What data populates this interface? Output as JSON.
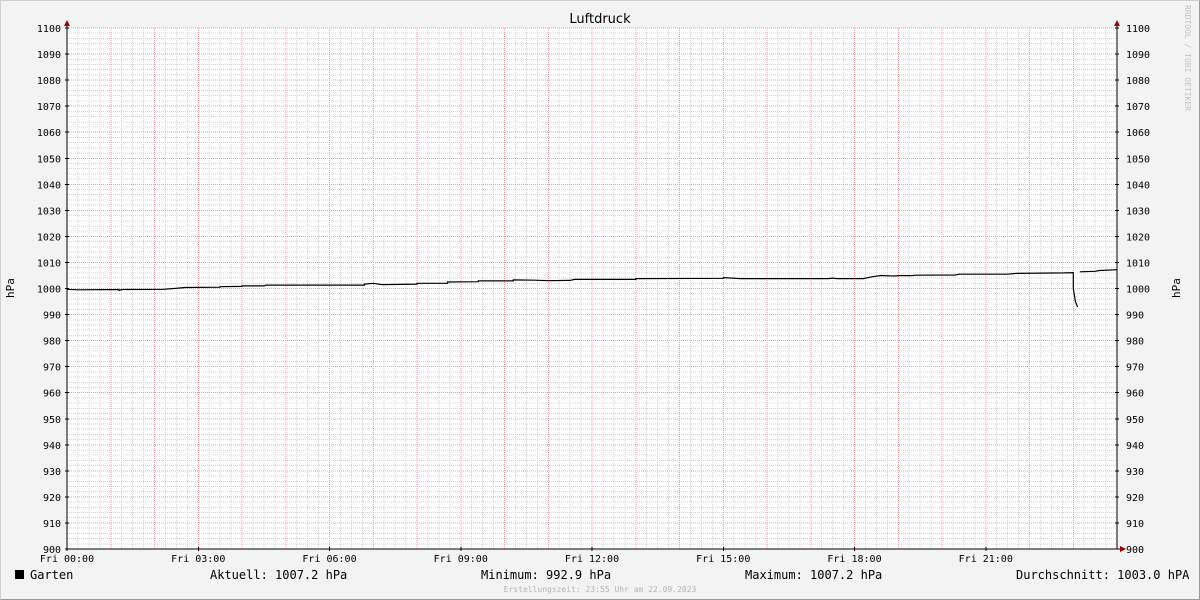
{
  "chart_data": {
    "type": "line",
    "title": "Luftdruck",
    "ylabel_left": "hPa",
    "ylabel_right": "hPa",
    "ylim": [
      900,
      1100
    ],
    "xlim_hours": [
      0,
      24
    ],
    "y_ticks": [
      900,
      910,
      920,
      930,
      940,
      950,
      960,
      970,
      980,
      990,
      1000,
      1010,
      1020,
      1030,
      1040,
      1050,
      1060,
      1070,
      1080,
      1090,
      1100
    ],
    "x_ticks": [
      {
        "hour": 0,
        "label": "Fri 00:00"
      },
      {
        "hour": 3,
        "label": "Fri 03:00"
      },
      {
        "hour": 6,
        "label": "Fri 06:00"
      },
      {
        "hour": 9,
        "label": "Fri 09:00"
      },
      {
        "hour": 12,
        "label": "Fri 12:00"
      },
      {
        "hour": 15,
        "label": "Fri 15:00"
      },
      {
        "hour": 18,
        "label": "Fri 18:00"
      },
      {
        "hour": 21,
        "label": "Fri 21:00"
      }
    ],
    "grid": true,
    "series": [
      {
        "name": "Garten",
        "color": "#000000",
        "segments": [
          [
            [
              0.0,
              999.7
            ],
            [
              0.25,
              999.5
            ],
            [
              1.2,
              999.6
            ],
            [
              1.15,
              999.6
            ],
            [
              1.2,
              999.3
            ],
            [
              1.25,
              999.6
            ],
            [
              2.2,
              999.7
            ],
            [
              2.45,
              1000.0
            ],
            [
              2.7,
              1000.4
            ],
            [
              3.5,
              1000.5
            ],
            [
              3.5,
              1000.7
            ],
            [
              4.0,
              1000.8
            ],
            [
              4.0,
              1001.0
            ],
            [
              4.5,
              1001.0
            ],
            [
              4.55,
              1001.3
            ],
            [
              6.8,
              1001.3
            ],
            [
              6.8,
              1001.7
            ],
            [
              7.0,
              1002.0
            ],
            [
              7.2,
              1001.5
            ],
            [
              8.0,
              1001.7
            ],
            [
              8.0,
              1002.0
            ],
            [
              8.7,
              1002.0
            ],
            [
              8.7,
              1002.5
            ],
            [
              9.4,
              1002.6
            ],
            [
              9.4,
              1002.9
            ],
            [
              10.2,
              1002.9
            ],
            [
              10.2,
              1003.3
            ],
            [
              10.7,
              1003.2
            ],
            [
              11.0,
              1003.0
            ],
            [
              11.5,
              1003.1
            ],
            [
              11.6,
              1003.5
            ],
            [
              13.0,
              1003.5
            ],
            [
              13.0,
              1003.8
            ],
            [
              15.0,
              1003.9
            ],
            [
              15.0,
              1004.2
            ],
            [
              15.2,
              1004.0
            ],
            [
              15.4,
              1003.8
            ],
            [
              17.4,
              1003.8
            ],
            [
              17.5,
              1004.0
            ],
            [
              17.6,
              1003.8
            ],
            [
              18.2,
              1003.8
            ],
            [
              18.4,
              1004.5
            ],
            [
              18.6,
              1005.0
            ],
            [
              18.9,
              1004.8
            ],
            [
              19.1,
              1005.0
            ],
            [
              19.3,
              1004.9
            ],
            [
              19.4,
              1005.1
            ],
            [
              20.3,
              1005.2
            ],
            [
              20.4,
              1005.5
            ],
            [
              21.5,
              1005.5
            ],
            [
              21.7,
              1005.8
            ],
            [
              22.8,
              1006.0
            ],
            [
              23.0,
              1006.1
            ],
            [
              23.0,
              1000.0
            ],
            [
              23.05,
              995.0
            ],
            [
              23.1,
              992.9
            ]
          ],
          [
            [
              23.15,
              1006.4
            ],
            [
              23.5,
              1006.6
            ],
            [
              23.6,
              1006.9
            ],
            [
              24.0,
              1007.2
            ]
          ]
        ]
      }
    ],
    "legend": {
      "series_label": "Garten",
      "current": "Aktuell: 1007.2 hPa",
      "minimum": "Minimum: 992.9 hPa",
      "maximum": "Maximum: 1007.2 hPa",
      "average": "Durchschnitt: 1003.0 hPA"
    },
    "footer": "Erstellungszeit: 23:55 Uhr am 22.09.2023",
    "credit": "RRDTOOL / TOBI OETIKER",
    "colors": {
      "background": "#f3f3f3",
      "plot_background": "#ffffff",
      "major_grid": "#e8a0a8",
      "minor_grid": "#d4d4d4",
      "axis": "#000000",
      "arrow": "#a00000",
      "line": "#000000"
    }
  }
}
